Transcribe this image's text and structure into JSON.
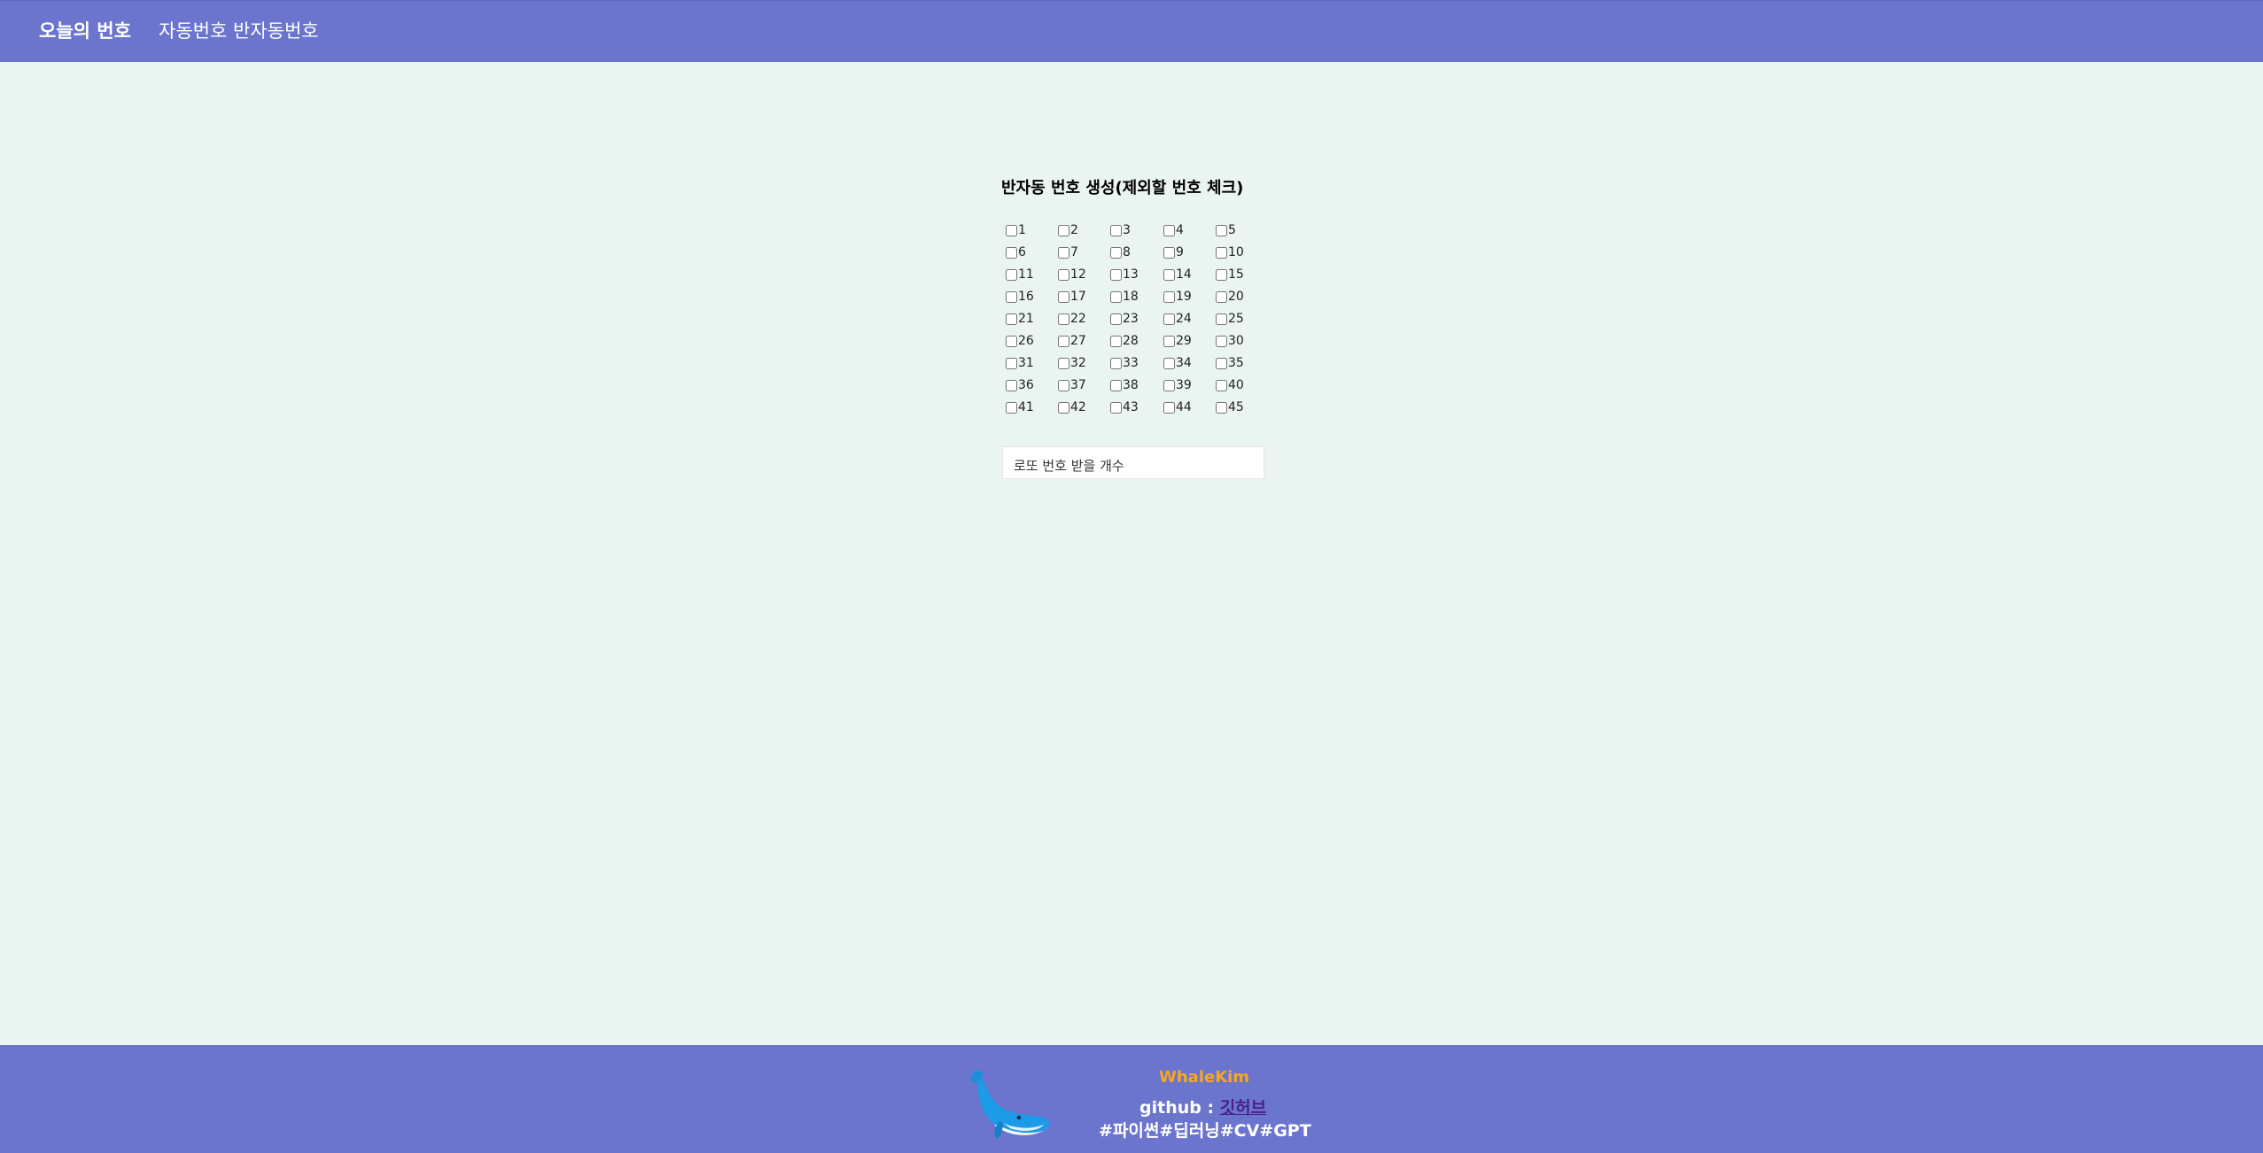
{
  "nav": {
    "brand": "오늘의 번호",
    "links": [
      "자동번호",
      "반자동번호"
    ]
  },
  "main": {
    "title": "반자동 번호 생성(제외할 번호 체크)",
    "numbers": [
      "1",
      "2",
      "3",
      "4",
      "5",
      "6",
      "7",
      "8",
      "9",
      "10",
      "11",
      "12",
      "13",
      "14",
      "15",
      "16",
      "17",
      "18",
      "19",
      "20",
      "21",
      "22",
      "23",
      "24",
      "25",
      "26",
      "27",
      "28",
      "29",
      "30",
      "31",
      "32",
      "33",
      "34",
      "35",
      "36",
      "37",
      "38",
      "39",
      "40",
      "41",
      "42",
      "43",
      "44",
      "45"
    ],
    "count_placeholder": "로또 번호 받을 개수"
  },
  "footer": {
    "name": "WhaleKim",
    "github_label": "github : ",
    "github_link": "깃허브",
    "tags": "#파이썬#딥러닝#CV#GPT",
    "whale_icon": "whale-icon"
  },
  "colors": {
    "nav_bg": "#6b75cd",
    "page_bg": "#eaf4f1",
    "name": "#f5a623",
    "link": "#4b1f8c"
  }
}
